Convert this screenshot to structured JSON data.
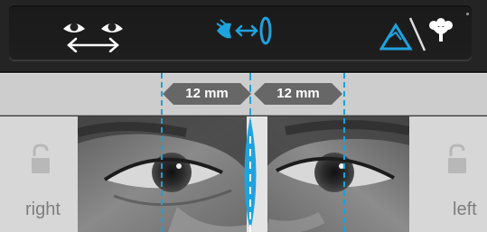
{
  "toolbar": {
    "buttons": [
      {
        "icon": "eyes-distance-icon",
        "color": "#ffffff"
      },
      {
        "icon": "eye-lens-distance-icon",
        "color": "#1fa3df"
      },
      {
        "icon": "near-far-vision-icon",
        "color": "#1fa3df"
      }
    ]
  },
  "measurements": {
    "right_value": "12 mm",
    "left_value": "12 mm"
  },
  "sides": {
    "right_label": "right",
    "left_label": "left"
  },
  "colors": {
    "accent": "#1fa3df",
    "tag_bg": "#676767",
    "toolbar_bg": "#242424"
  }
}
